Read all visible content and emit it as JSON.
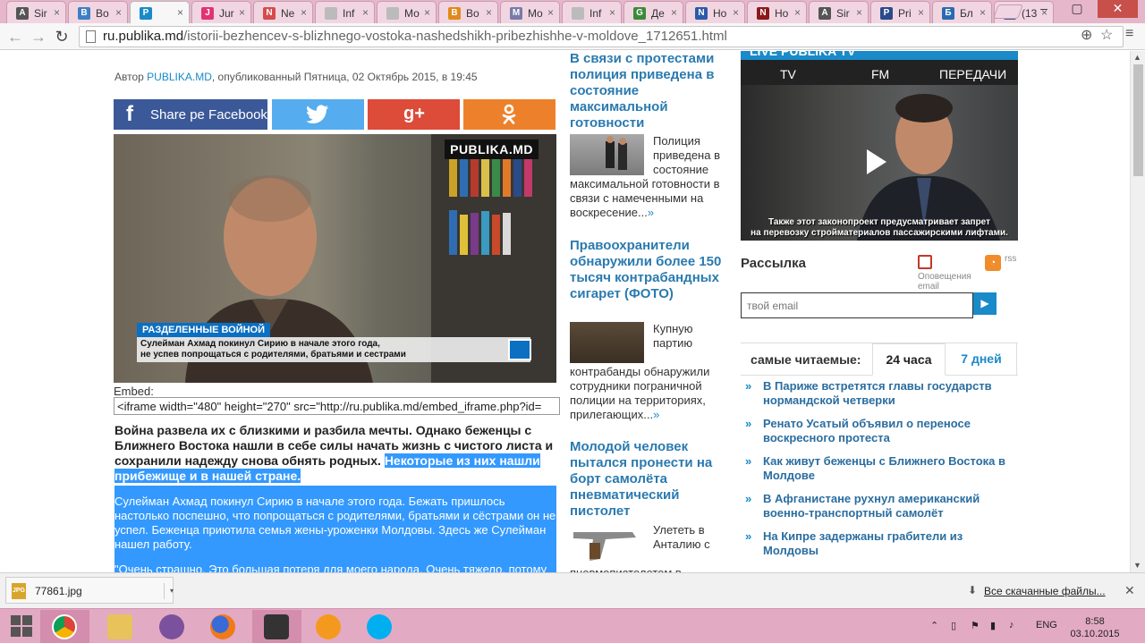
{
  "browser": {
    "tabs": [
      {
        "label": "Sir",
        "color": "#555555",
        "glyph": "A"
      },
      {
        "label": "Во",
        "color": "#3d7fc4",
        "glyph": "B"
      },
      {
        "label": "",
        "color": "#1a8ac8",
        "glyph": "P"
      },
      {
        "label": "Jur",
        "color": "#e0336f",
        "glyph": "J"
      },
      {
        "label": "Ne",
        "color": "#d64b4b",
        "glyph": "N"
      },
      {
        "label": "Inf",
        "color": "#bbbbbb",
        "glyph": ""
      },
      {
        "label": "Мо",
        "color": "#bbbbbb",
        "glyph": ""
      },
      {
        "label": "Во",
        "color": "#e08a1a",
        "glyph": "B"
      },
      {
        "label": "Mo",
        "color": "#7a7aa8",
        "glyph": "M"
      },
      {
        "label": "Inf",
        "color": "#bbbbbb",
        "glyph": ""
      },
      {
        "label": "Де",
        "color": "#3a8a3a",
        "glyph": "G"
      },
      {
        "label": "Но",
        "color": "#2c5aa8",
        "glyph": "N"
      },
      {
        "label": "Но",
        "color": "#8a1a1a",
        "glyph": "N"
      },
      {
        "label": "Sir",
        "color": "#555555",
        "glyph": "A"
      },
      {
        "label": "Pri",
        "color": "#2a4a8a",
        "glyph": "P"
      },
      {
        "label": "Бл",
        "color": "#2a6ab0",
        "glyph": "Б"
      },
      {
        "label": "(13",
        "color": "#3b5998",
        "glyph": "f"
      }
    ],
    "url_host": "ru.publika.md",
    "url_path": "/istorii-bezhencev-s-blizhnego-vostoka-nashedshikh-pribezhishhe-v-moldove_1712651.html"
  },
  "article": {
    "byline_prefix": "Автор",
    "author": "PUBLIKA.MD",
    "byline_suffix": ", опубликованный Пятница, 02 Октябрь 2015, в 19:45",
    "share_facebook": "Share pe Facebook",
    "video": {
      "logo": "PUBLIKA.MD",
      "strap": "РАЗДЕЛЕННЫЕ ВОЙНОЙ",
      "caption_line1": "Сулейман Ахмад покинул Сирию в начале этого года,",
      "caption_line2": "не успев попрощаться с родителями, братьями и сестрами"
    },
    "embed_label": "Embed:",
    "embed_code": "<iframe width=\"480\" height=\"270\" src=\"http://ru.publika.md/embed_iframe.php?id=",
    "lead_plain": "Война развела их с близкими и разбила мечты. Однако беженцы с Ближнего Востока нашли в себе силы начать жизнь с чистого листа и сохранили надежду снова обнять родных. ",
    "lead_selected": "Некоторые из них нашли прибежище и в нашей стране.",
    "para1": "Сулейман Ахмад покинул Сирию в начале этого года. Бежать пришлось настолько поспешно, что попрощаться с родителями, братьями и сёстрами он не успел. Беженца приютила семья жены-уроженки Молдовы. Здесь же Сулейман нашел работу.",
    "para2": "\"Очень страшно. Это большая потеря для моего народа. Очень тяжело, потому"
  },
  "middle": [
    {
      "title": "В связи с протестами полиция приведена в состояние максимальной готовности",
      "text": "Полиция приведена в состояние максимальной готовности в связи с намеченными на воскресение...",
      "more": "»"
    },
    {
      "title": "Правоохранители обнаружили более 150 тысяч контрабандных сигарет (ФОТО)",
      "text": "Купную партию контрабанды обнаружили сотрудники пограничной полиции на территориях, прилегающих...",
      "more": "»"
    },
    {
      "title": "Молодой человек пытался пронести на борт самолёта пневматический пистолет",
      "text": "Улететь в Анталию с пневмопистолетом в",
      "more": ""
    }
  ],
  "right": {
    "tv_header": "LIVE PUBLIKA TV",
    "tv_nav": [
      "TV",
      "FM",
      "ПЕРЕДАЧИ"
    ],
    "tv_sub1": "Также этот законопроект предусматривает запрет",
    "tv_sub2": "на перевозку стройматериалов пассажирскими лифтами.",
    "newsletter": "Рассылка",
    "alerts_label": "Оповещения email",
    "rss_label": "rss",
    "email_placeholder": "твой email",
    "mostread_label": "самые читаемые:",
    "tab_24h": "24 часа",
    "tab_7d": "7 дней",
    "mostread": [
      "В Париже встретятся главы государств нормандской четверки",
      "Ренато Усатый объявил о переносе воскресного протеста",
      "Как живут беженцы с Ближнего Востока в Молдове",
      "В Афганистане рухнул американский военно-транспортный самолёт",
      "На Кипре задержаны грабители из Молдовы"
    ]
  },
  "downloads": {
    "file": "77861.jpg",
    "all_link": "Все скачанные файлы..."
  },
  "taskbar": {
    "lang": "ENG",
    "time": "8:58",
    "date": "03.10.2015"
  }
}
